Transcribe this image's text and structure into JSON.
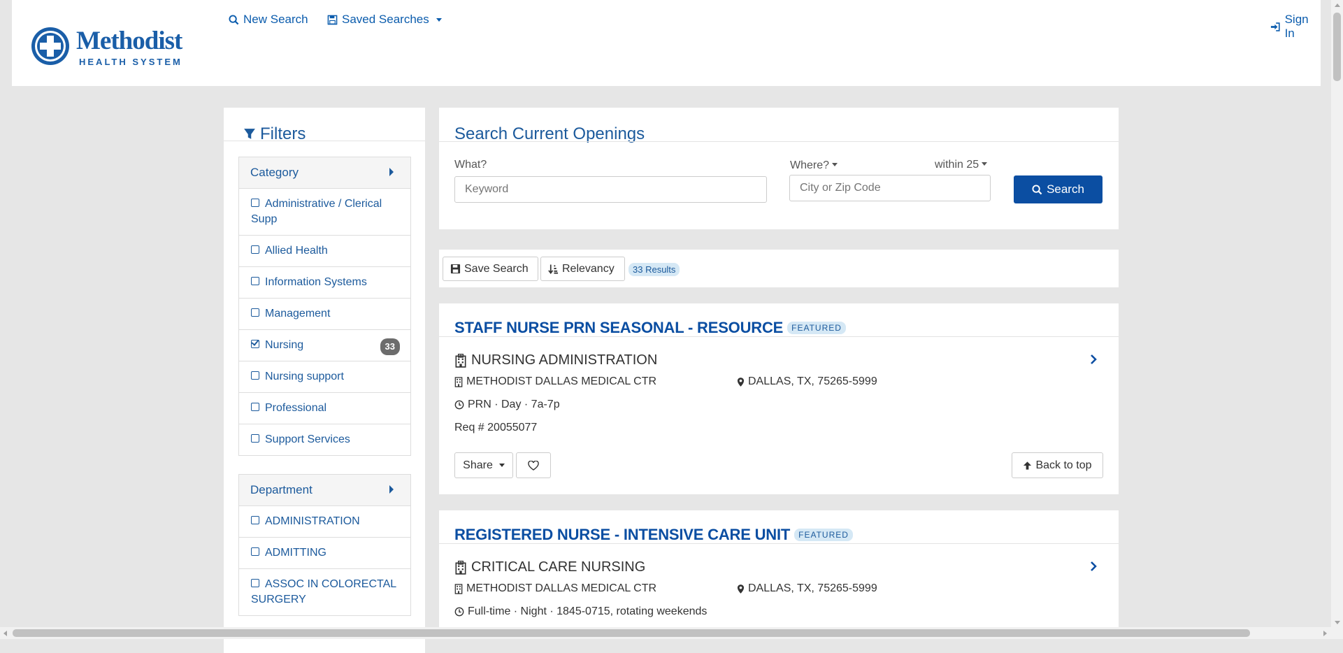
{
  "brand": {
    "name": "Methodist",
    "subtitle": "HEALTH SYSTEM",
    "color": "#1a5ea8"
  },
  "nav": {
    "new_search": "New Search",
    "saved_searches": "Saved Searches",
    "sign_in": "Sign In"
  },
  "filters": {
    "title": "Filters",
    "category": {
      "label": "Category",
      "items": [
        {
          "label": "Administrative / Clerical Supp",
          "checked": false
        },
        {
          "label": "Allied Health",
          "checked": false
        },
        {
          "label": "Information Systems",
          "checked": false
        },
        {
          "label": "Management",
          "checked": false
        },
        {
          "label": "Nursing",
          "checked": true,
          "count": "33"
        },
        {
          "label": "Nursing support",
          "checked": false
        },
        {
          "label": "Professional",
          "checked": false
        },
        {
          "label": "Support Services",
          "checked": false
        }
      ]
    },
    "department": {
      "label": "Department",
      "items": [
        {
          "label": "ADMINISTRATION",
          "checked": false
        },
        {
          "label": "ADMITTING",
          "checked": false
        },
        {
          "label": "ASSOC IN COLORECTAL SURGERY",
          "checked": false
        }
      ]
    }
  },
  "search": {
    "title": "Search Current Openings",
    "what_label": "What?",
    "what_placeholder": "Keyword",
    "where_label": "Where?",
    "within_label": "within 25",
    "where_placeholder": "City or Zip Code",
    "button": "Search"
  },
  "toolbar": {
    "save_search": "Save Search",
    "sort": "Relevancy",
    "results": "33 Results"
  },
  "jobs": [
    {
      "title": "STAFF NURSE PRN SEASONAL - RESOURCE",
      "featured": "FEATURED",
      "department": "NURSING ADMINISTRATION",
      "facility": "METHODIST DALLAS MEDICAL CTR",
      "location": "DALLAS, TX, 75265-5999",
      "schedule": "PRN · Day · 7a-7p",
      "req": "Req # 20055077",
      "share": "Share",
      "back_to_top": "Back to top"
    },
    {
      "title": "REGISTERED NURSE - INTENSIVE CARE UNIT",
      "featured": "FEATURED",
      "department": "CRITICAL CARE NURSING",
      "facility": "METHODIST DALLAS MEDICAL CTR",
      "location": "DALLAS, TX, 75265-5999",
      "schedule": "Full-time · Night · 1845-0715, rotating weekends"
    }
  ]
}
